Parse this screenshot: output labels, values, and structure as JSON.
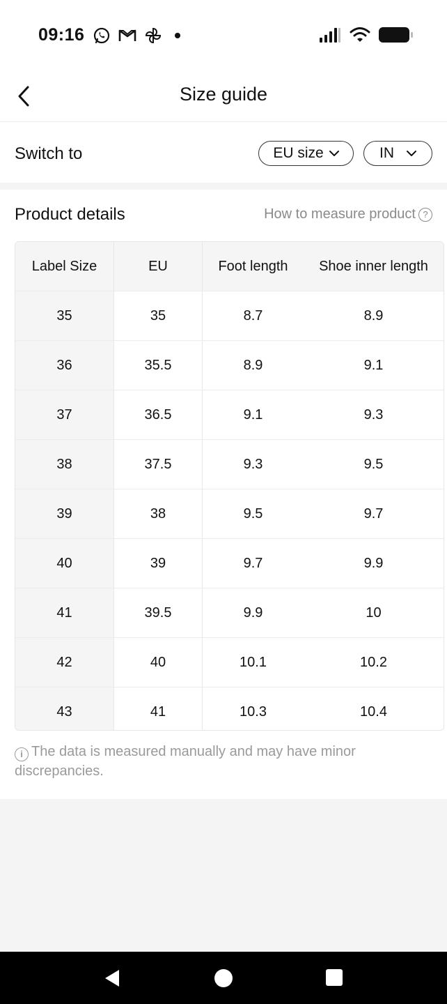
{
  "status_bar": {
    "time": "09:16",
    "left_icons": [
      "whatsapp-icon",
      "gmail-icon",
      "pinwheel-icon",
      "dot-icon"
    ],
    "right_icons": [
      "signal-icon",
      "wifi-icon",
      "battery-icon"
    ]
  },
  "header": {
    "title": "Size guide",
    "back_icon": "chevron-left-icon"
  },
  "switch_row": {
    "label": "Switch to",
    "size_system": "EU size",
    "unit": "IN"
  },
  "product_details": {
    "title": "Product details",
    "measure_link": "How to measure product",
    "help_glyph": "?",
    "table": {
      "headers": [
        "Label Size",
        "EU",
        "Foot length",
        "Shoe inner length"
      ],
      "rows": [
        [
          "35",
          "35",
          "8.7",
          "8.9"
        ],
        [
          "36",
          "35.5",
          "8.9",
          "9.1"
        ],
        [
          "37",
          "36.5",
          "9.1",
          "9.3"
        ],
        [
          "38",
          "37.5",
          "9.3",
          "9.5"
        ],
        [
          "39",
          "38",
          "9.5",
          "9.7"
        ],
        [
          "40",
          "39",
          "9.7",
          "9.9"
        ],
        [
          "41",
          "39.5",
          "9.9",
          "10"
        ],
        [
          "42",
          "40",
          "10.1",
          "10.2"
        ],
        [
          "43",
          "41",
          "10.3",
          "10.4"
        ]
      ]
    },
    "note_glyph": "i",
    "note": "The data is measured manually and may have minor discrepancies."
  },
  "nav_bar": {
    "buttons": [
      "back-triangle-icon",
      "home-circle-icon",
      "recents-square-icon"
    ]
  },
  "colors": {
    "text": "#111111",
    "muted": "#8a8a8a",
    "table_header_bg": "#f5f5f5",
    "page_bg": "#f4f4f4"
  }
}
